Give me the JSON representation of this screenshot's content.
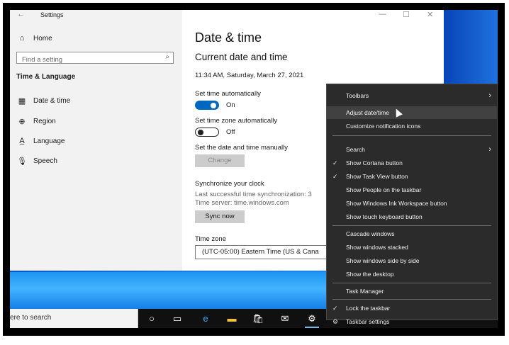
{
  "settings": {
    "app_title": "Settings",
    "back_icon": "back-arrow-icon",
    "window_controls": {
      "minimize": "—",
      "maximize": "☐",
      "close": "✕"
    },
    "sidebar": {
      "home_label": "Home",
      "search_placeholder": "Find a setting",
      "section_heading": "Time & Language",
      "items": [
        {
          "label": "Date & time",
          "icon": "calendar-clock-icon"
        },
        {
          "label": "Region",
          "icon": "globe-icon"
        },
        {
          "label": "Language",
          "icon": "language-icon"
        },
        {
          "label": "Speech",
          "icon": "microphone-icon"
        }
      ]
    },
    "main": {
      "page_title": "Date & time",
      "subtitle": "Current date and time",
      "current_datetime": "11:34 AM, Saturday, March 27, 2021",
      "set_time_auto_label": "Set time automatically",
      "set_time_auto_state": "On",
      "set_tz_auto_label": "Set time zone automatically",
      "set_tz_auto_state": "Off",
      "manual_label": "Set the date and time manually",
      "change_button": "Change",
      "sync_heading": "Synchronize your clock",
      "last_sync": "Last successful time synchronization: 3",
      "time_server": "Time server: time.windows.com",
      "sync_button": "Sync now",
      "timezone_label": "Time zone",
      "timezone_value": "(UTC-05:00) Eastern Time (US & Cana"
    }
  },
  "taskbar": {
    "search_text": "ere to search",
    "icons": [
      "cortana-circle-icon",
      "task-view-icon",
      "edge-icon",
      "file-explorer-icon",
      "store-icon",
      "mail-icon",
      "settings-gear-icon"
    ]
  },
  "context_menu": {
    "items": [
      {
        "label": "Toolbars",
        "submenu": true,
        "checked": false
      },
      {
        "label": "Adjust date/time",
        "submenu": false,
        "checked": false,
        "hover": true
      },
      {
        "label": "Customize notification icons",
        "submenu": false,
        "checked": false
      },
      {
        "label": "Search",
        "submenu": true,
        "checked": false
      },
      {
        "label": "Show Cortana button",
        "submenu": false,
        "checked": true
      },
      {
        "label": "Show Task View button",
        "submenu": false,
        "checked": true
      },
      {
        "label": "Show People on the taskbar",
        "submenu": false,
        "checked": false
      },
      {
        "label": "Show Windows Ink Workspace button",
        "submenu": false,
        "checked": false
      },
      {
        "label": "Show touch keyboard button",
        "submenu": false,
        "checked": false
      },
      {
        "label": "Cascade windows",
        "submenu": false,
        "checked": false
      },
      {
        "label": "Show windows stacked",
        "submenu": false,
        "checked": false
      },
      {
        "label": "Show windows side by side",
        "submenu": false,
        "checked": false
      },
      {
        "label": "Show the desktop",
        "submenu": false,
        "checked": false
      },
      {
        "label": "Task Manager",
        "submenu": false,
        "checked": false
      },
      {
        "label": "Lock the taskbar",
        "submenu": false,
        "checked": true
      },
      {
        "label": "Taskbar settings",
        "submenu": false,
        "checked": false,
        "icon": "gear-icon"
      }
    ]
  },
  "colors": {
    "accent": "#0067c0",
    "menu_bg": "#2b2b2b",
    "taskbar_bg": "#101010"
  }
}
